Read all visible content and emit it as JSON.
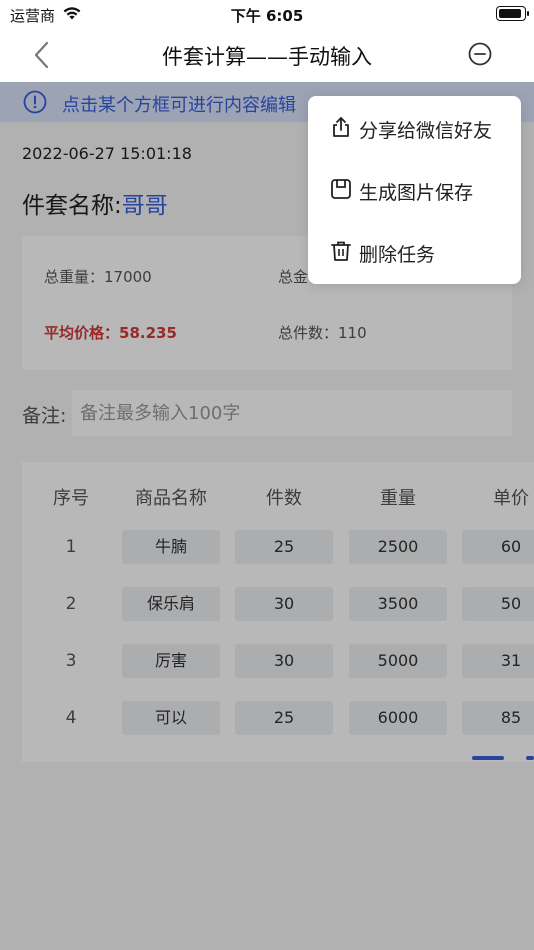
{
  "status_bar": {
    "carrier": "运营商",
    "time": "下午 6:05"
  },
  "nav": {
    "title": "件套计算——手动输入"
  },
  "notice": {
    "text": "点击某个方框可进行内容编辑"
  },
  "record": {
    "datetime": "2022-06-27 15:01:18",
    "name_label": "件套名称:",
    "name_value": "哥哥"
  },
  "summary": {
    "total_weight": "总重量：17000",
    "total_amount": "总金",
    "avg_price": "平均价格：58.235",
    "total_count": "总件数：110"
  },
  "remark": {
    "label": "备注:",
    "placeholder": "备注最多输入100字"
  },
  "table": {
    "headers": [
      "序号",
      "商品名称",
      "件数",
      "重量",
      "单价"
    ],
    "rows": [
      [
        "1",
        "牛腩",
        "25",
        "2500",
        "60"
      ],
      [
        "2",
        "保乐肩",
        "30",
        "3500",
        "50"
      ],
      [
        "3",
        "厉害",
        "30",
        "5000",
        "31"
      ],
      [
        "4",
        "可以",
        "25",
        "6000",
        "85"
      ]
    ]
  },
  "menu": {
    "share": "分享给微信好友",
    "save_image": "生成图片保存",
    "delete": "删除任务"
  },
  "colors": {
    "accent": "#3a5fdc",
    "highlight_red": "#d63a3a",
    "notice_bg": "#d8e2fa"
  }
}
